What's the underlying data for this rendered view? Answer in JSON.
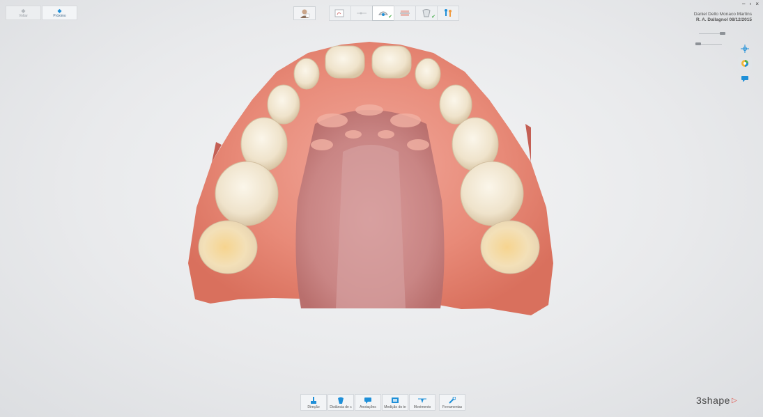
{
  "nav": {
    "back_label": "Voltar",
    "next_label": "Próximo"
  },
  "patient": {
    "name": "Daniel Dello Monaco Martins",
    "doctor_date": "R. A. Dallagnol 08/12/2015"
  },
  "window": {
    "minimize": "–",
    "maximize": "▫",
    "close": "×"
  },
  "workflow_steps": [
    {
      "icon": "prescription-icon",
      "checked": false
    },
    {
      "icon": "settings-slider-icon",
      "checked": false
    },
    {
      "icon": "scan-analysis-icon",
      "checked": true
    },
    {
      "icon": "jaw-icon",
      "checked": false
    },
    {
      "icon": "tooth-shield-icon",
      "checked": true
    },
    {
      "icon": "patient-figure-icon",
      "checked": false
    }
  ],
  "toolbar": {
    "direcao": "Direção",
    "distancia": "Distância de c",
    "anotacoes": "Anotações",
    "medicao": "Medição do te",
    "movimento": "Movimento",
    "ferramentas": "Ferramentas"
  },
  "brand": {
    "name": "3shape"
  },
  "colors": {
    "accent": "#1e8fd8",
    "check": "#4caf50",
    "brand_triangle": "#e0453a"
  }
}
